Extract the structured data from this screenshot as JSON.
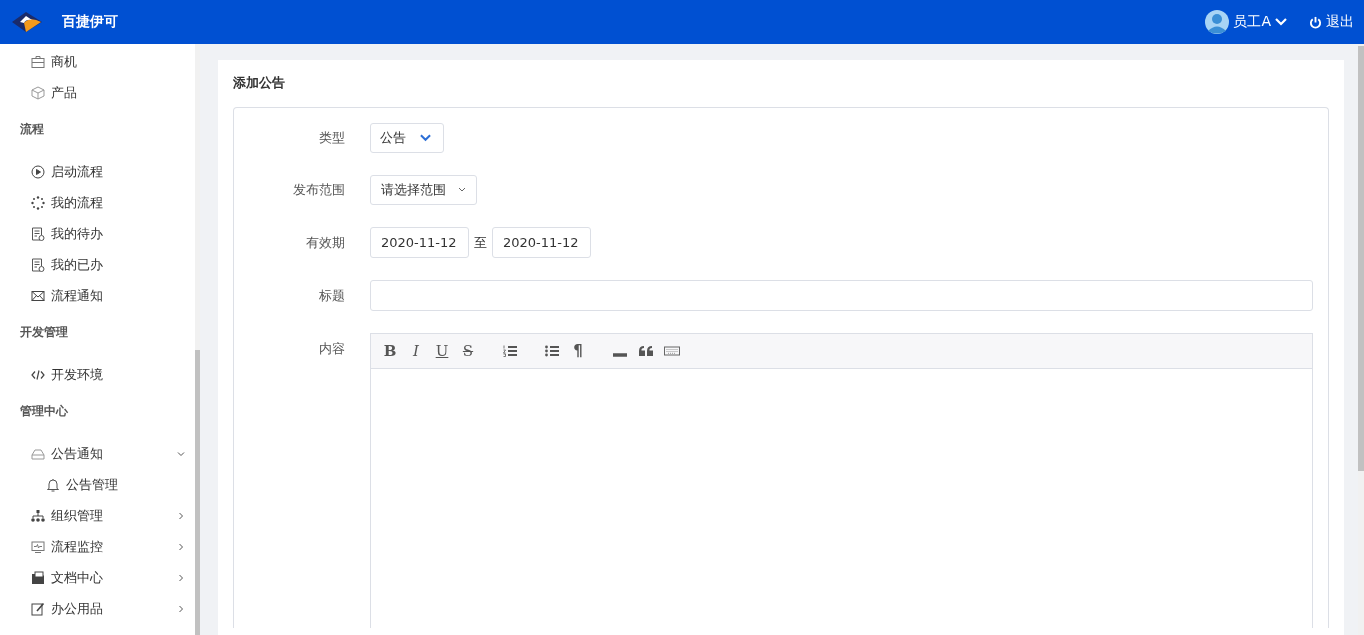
{
  "header": {
    "brand": "百捷伊可",
    "user": "员工A",
    "logout": "退出"
  },
  "sidebar": {
    "groups": [
      {
        "items": [
          {
            "label": "商机"
          },
          {
            "label": "产品"
          }
        ]
      },
      {
        "title": "流程",
        "items": [
          {
            "label": "启动流程"
          },
          {
            "label": "我的流程"
          },
          {
            "label": "我的待办"
          },
          {
            "label": "我的已办"
          },
          {
            "label": "流程通知"
          }
        ]
      },
      {
        "title": "开发管理",
        "items": [
          {
            "label": "开发环境"
          }
        ]
      },
      {
        "title": "管理中心",
        "items": [
          {
            "label": "公告通知",
            "expanded": true,
            "children": [
              {
                "label": "公告管理"
              }
            ]
          },
          {
            "label": "组织管理",
            "expanded": false
          },
          {
            "label": "流程监控",
            "expanded": false
          },
          {
            "label": "文档中心",
            "expanded": false
          },
          {
            "label": "办公用品",
            "expanded": false
          }
        ]
      }
    ]
  },
  "page": {
    "title": "添加公告",
    "form": {
      "type": {
        "label": "类型",
        "value": "公告"
      },
      "scope": {
        "label": "发布范围",
        "placeholder": "请选择范围"
      },
      "period": {
        "label": "有效期",
        "start": "2020-11-12",
        "separator": "至",
        "end": "2020-11-12"
      },
      "subject": {
        "label": "标题"
      },
      "content": {
        "label": "内容",
        "toolbar": [
          {
            "kind": "text",
            "label": "B"
          },
          {
            "kind": "text",
            "label": "I"
          },
          {
            "kind": "text",
            "label": "U"
          },
          {
            "kind": "text",
            "label": "S"
          },
          {
            "kind": "olist"
          },
          {
            "kind": "ulist"
          },
          {
            "kind": "text",
            "label": "¶"
          },
          {
            "kind": "hr"
          },
          {
            "kind": "quote"
          },
          {
            "kind": "keyboard"
          }
        ]
      }
    }
  }
}
